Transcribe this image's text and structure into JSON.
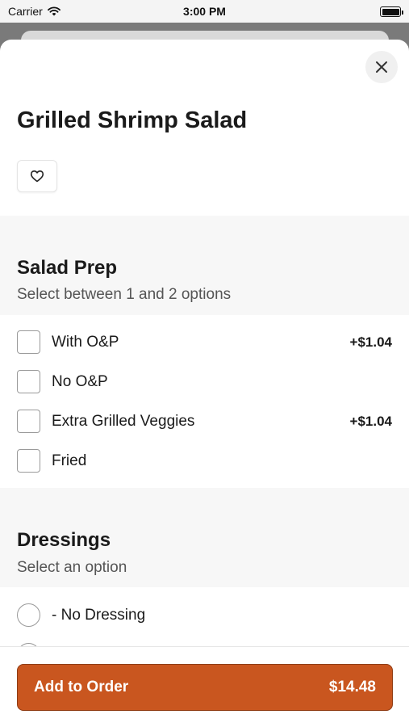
{
  "status_bar": {
    "carrier": "Carrier",
    "time": "3:00 PM"
  },
  "item": {
    "title": "Grilled Shrimp Salad"
  },
  "sections": [
    {
      "title": "Salad Prep",
      "subtitle": "Select between 1 and 2 options",
      "options": [
        {
          "label": "With O&P",
          "price": "+$1.04"
        },
        {
          "label": "No O&P",
          "price": ""
        },
        {
          "label": "Extra Grilled Veggies",
          "price": "+$1.04"
        },
        {
          "label": "Fried",
          "price": ""
        }
      ]
    },
    {
      "title": "Dressings",
      "subtitle": "Select an option",
      "options": [
        {
          "label": "- No Dressing",
          "price": ""
        }
      ]
    }
  ],
  "footer": {
    "add_label": "Add to Order",
    "total": "$14.48"
  },
  "colors": {
    "accent": "#c9561f",
    "section_bg": "#f7f7f7"
  }
}
